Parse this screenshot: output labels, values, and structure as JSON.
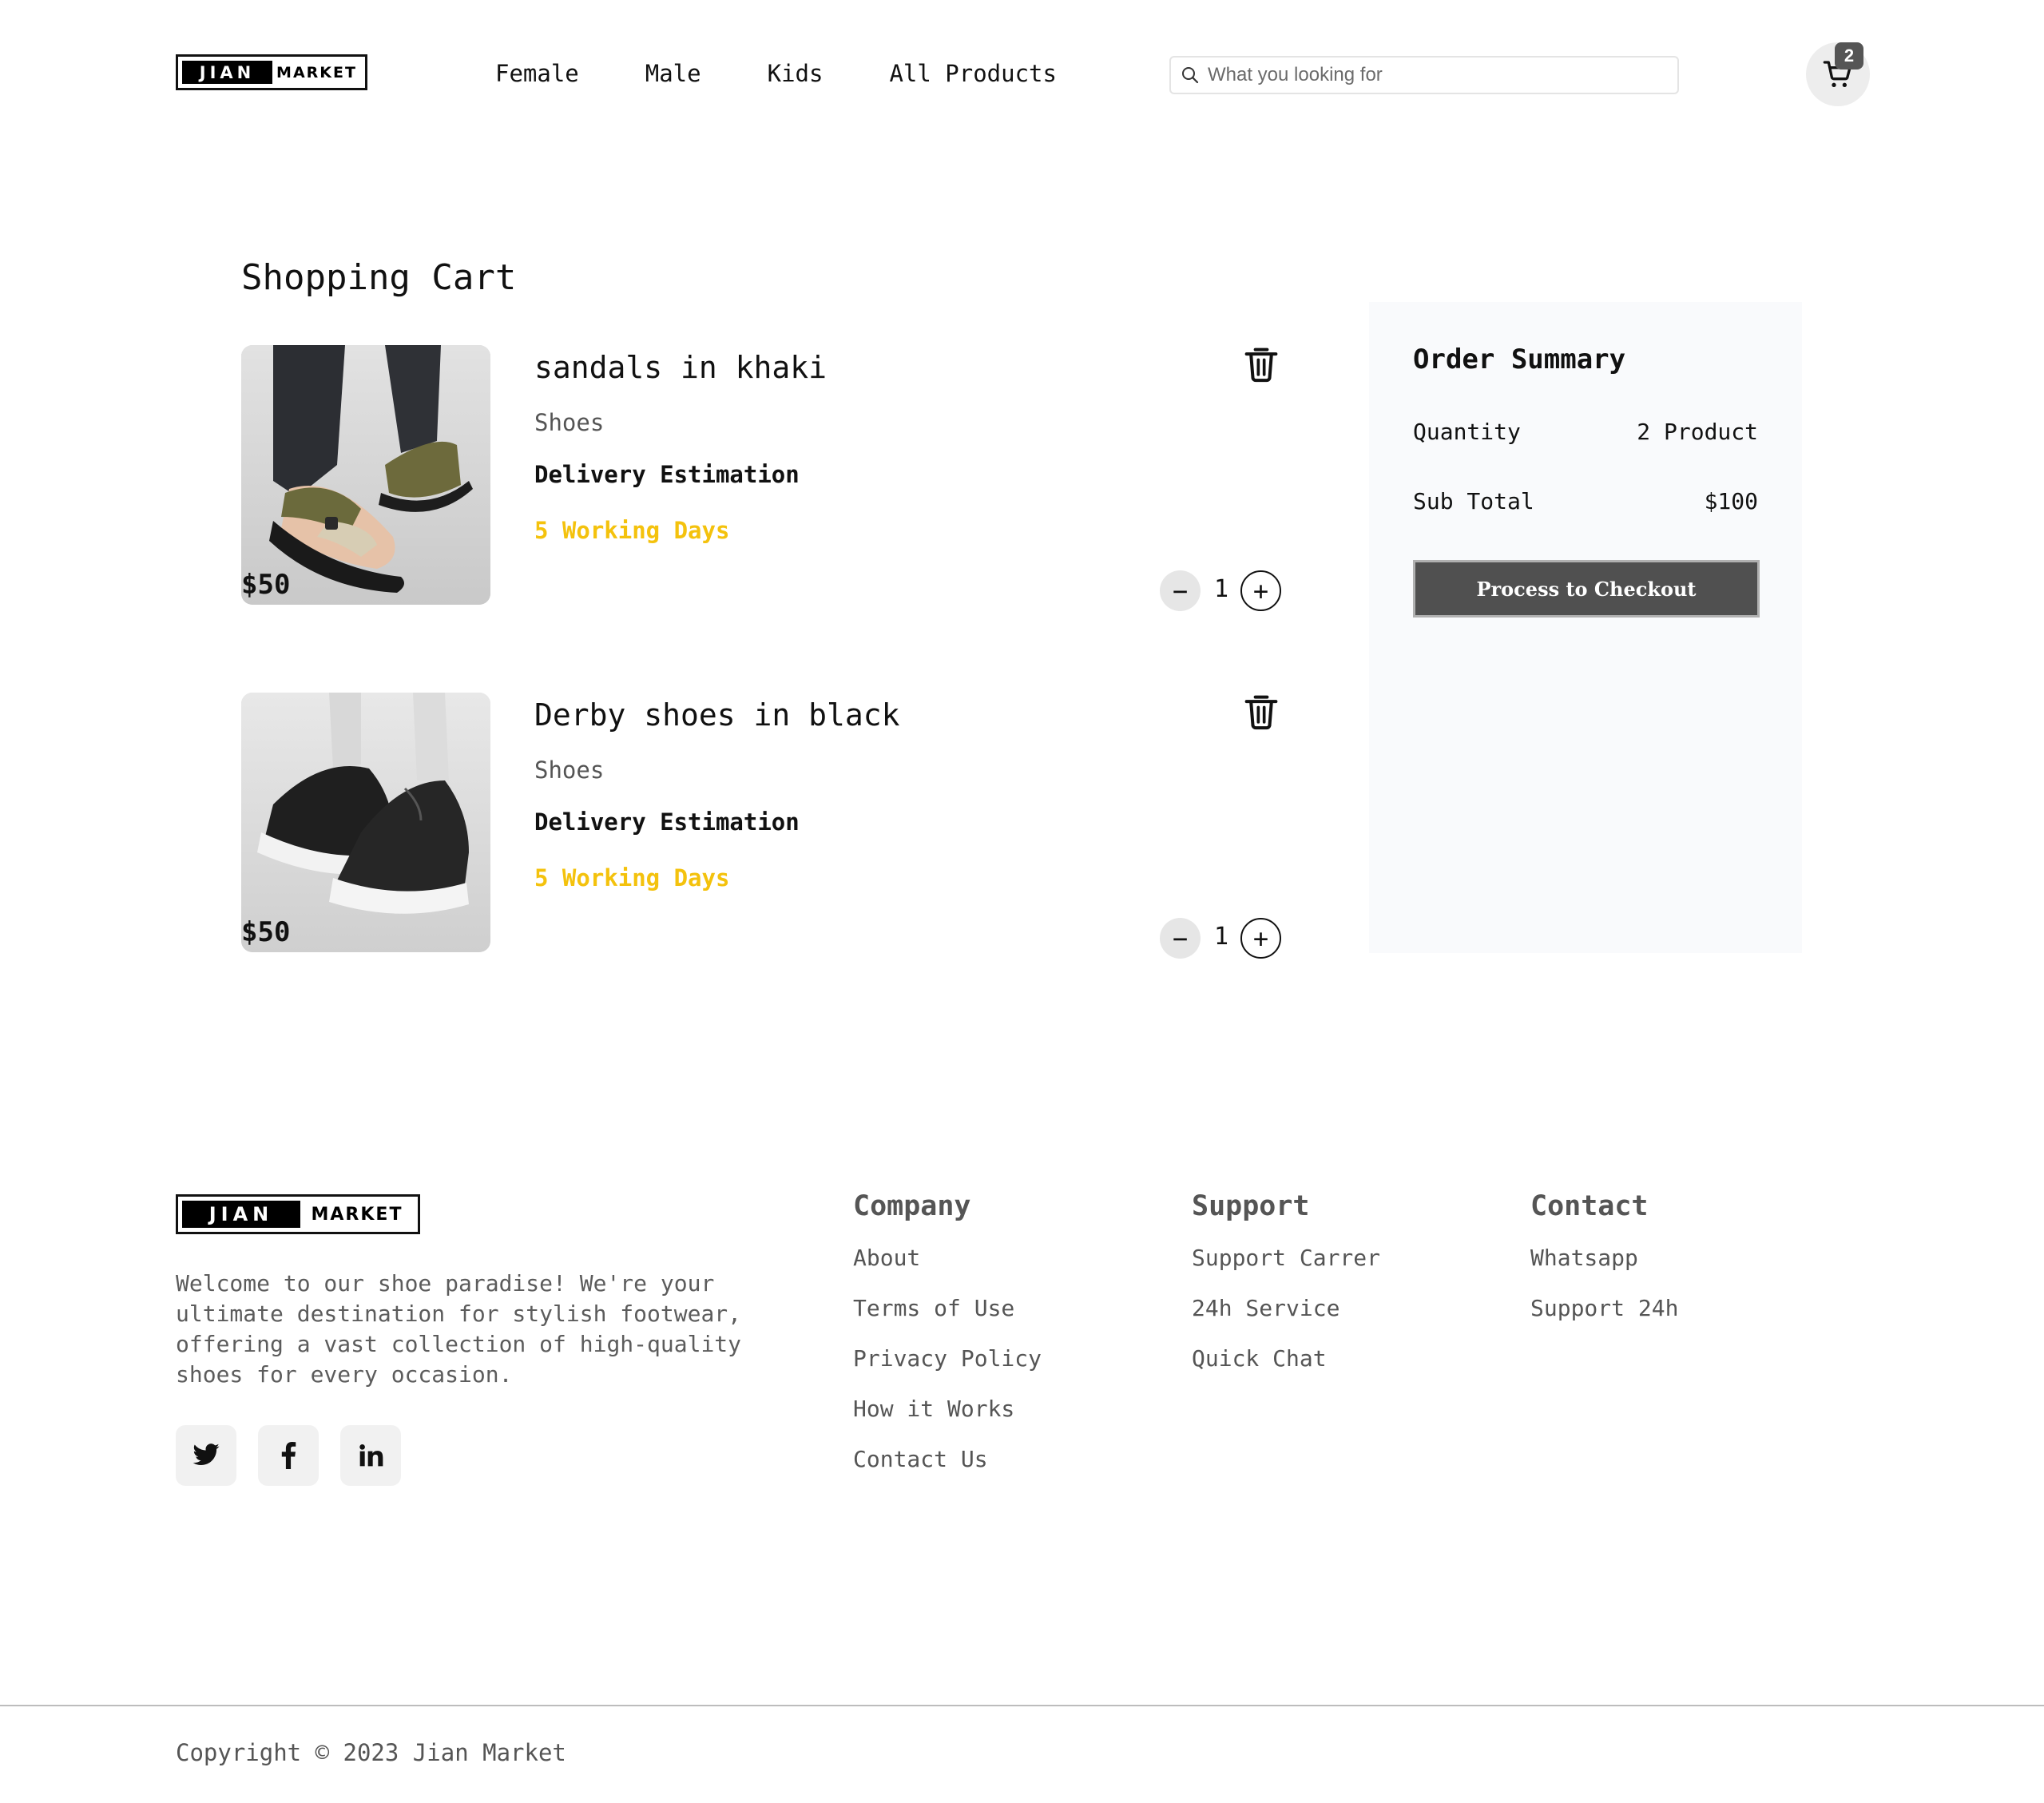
{
  "header": {
    "logo": {
      "part1": "JIAN",
      "part2": "MARKET"
    },
    "nav": [
      "Female",
      "Male",
      "Kids",
      "All Products"
    ],
    "search": {
      "placeholder": "What you looking for",
      "value": ""
    },
    "cart_count": "2"
  },
  "cart": {
    "title": "Shopping Cart",
    "items": [
      {
        "name": "sandals in khaki",
        "category": "Shoes",
        "delivery_label": "Delivery Estimation",
        "delivery_days": "5 Working Days",
        "price": "$50",
        "quantity": "1",
        "minus": "−",
        "plus": "+"
      },
      {
        "name": "Derby shoes in black",
        "category": "Shoes",
        "delivery_label": "Delivery Estimation",
        "delivery_days": "5 Working Days",
        "price": "$50",
        "quantity": "1",
        "minus": "−",
        "plus": "+"
      }
    ]
  },
  "summary": {
    "title": "Order Summary",
    "quantity_label": "Quantity",
    "quantity_value": "2 Product",
    "subtotal_label": "Sub Total",
    "subtotal_value": "$100",
    "checkout_label": "Process to Checkout"
  },
  "footer": {
    "logo": {
      "part1": "JIAN",
      "part2": "MARKET"
    },
    "about": "Welcome to our shoe paradise! We're your ultimate destination for stylish footwear, offering a vast collection of high-quality shoes for every occasion.",
    "social": [
      "twitter-icon",
      "facebook-icon",
      "linkedin-icon"
    ],
    "columns": [
      {
        "heading": "Company",
        "links": [
          "About",
          "Terms of Use",
          "Privacy Policy",
          "How it Works",
          "Contact Us"
        ]
      },
      {
        "heading": "Support",
        "links": [
          "Support Carrer",
          "24h Service",
          "Quick Chat"
        ]
      },
      {
        "heading": "Contact",
        "links": [
          "Whatsapp",
          "Support 24h"
        ]
      }
    ],
    "copyright": "Copyright © 2023 Jian Market"
  },
  "colors": {
    "accent_yellow": "#f4c20d",
    "checkout_bg": "#505050",
    "summary_bg": "#f9fafc",
    "badge_bg": "#555555"
  }
}
